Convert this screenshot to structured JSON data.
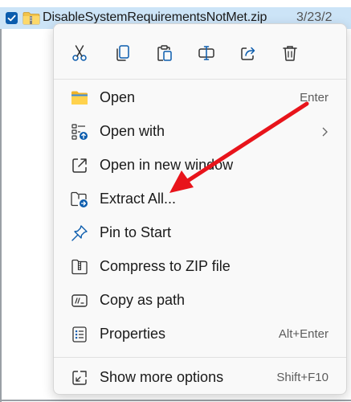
{
  "file": {
    "name": "DisableSystemRequirementsNotMet.zip",
    "date": "3/23/2"
  },
  "toolbar": {
    "icons": [
      "cut-icon",
      "copy-icon",
      "paste-icon",
      "rename-icon",
      "share-icon",
      "delete-icon"
    ]
  },
  "menu": {
    "items": [
      {
        "label": "Open",
        "shortcut": "Enter"
      },
      {
        "label": "Open with",
        "shortcut": ""
      },
      {
        "label": "Open in new window",
        "shortcut": ""
      },
      {
        "label": "Extract All...",
        "shortcut": ""
      },
      {
        "label": "Pin to Start",
        "shortcut": ""
      },
      {
        "label": "Compress to ZIP file",
        "shortcut": ""
      },
      {
        "label": "Copy as path",
        "shortcut": ""
      },
      {
        "label": "Properties",
        "shortcut": "Alt+Enter"
      },
      {
        "label": "Show more options",
        "shortcut": "Shift+F10"
      }
    ]
  },
  "colors": {
    "accent": "#0067c0",
    "selection": "#cce4f7",
    "arrow": "#e8141b"
  }
}
